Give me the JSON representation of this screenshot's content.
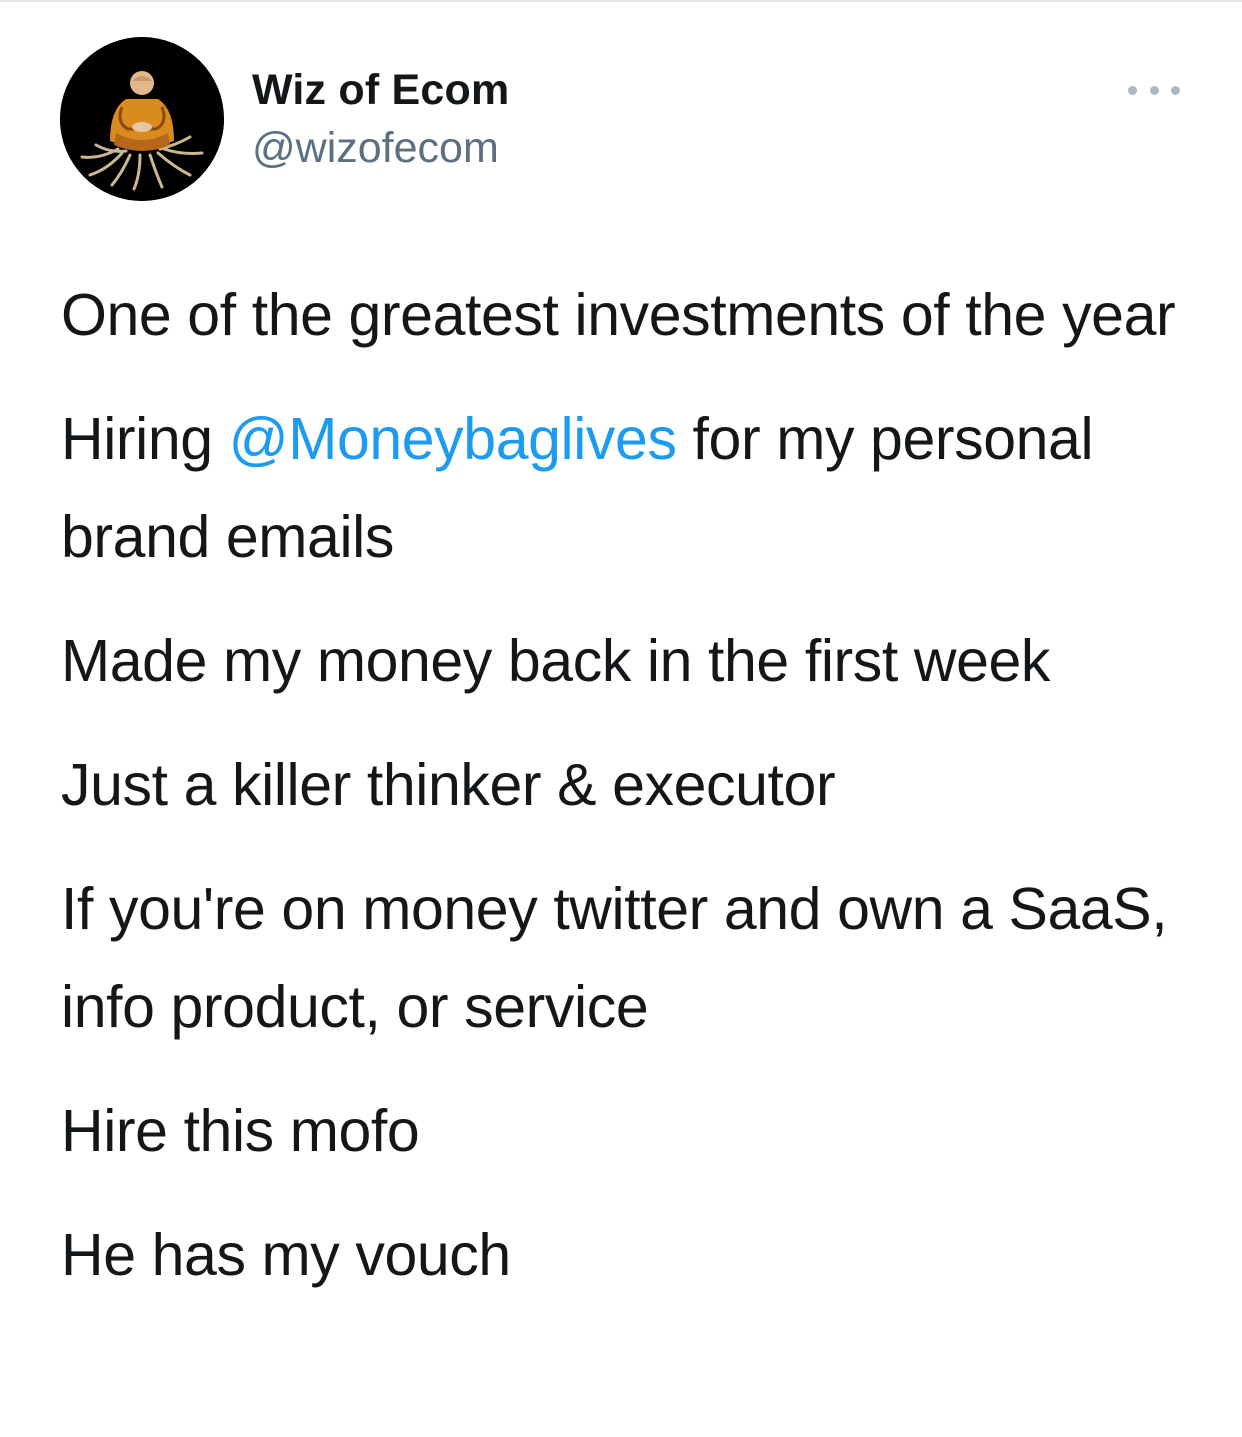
{
  "tweet": {
    "author": {
      "display_name": "Wiz of Ecom",
      "handle": "@wizofecom",
      "avatar_icon": "meditating-monk-avatar"
    },
    "more_icon": "more-options-icon",
    "lines": {
      "l1": "One of the greatest investments of the year",
      "l2_before": "Hiring ",
      "l2_mention": "@Moneybaglives",
      "l2_after": " for my personal brand emails",
      "l3": "Made my money back in the first week",
      "l4": "Just a killer thinker & executor",
      "l5": "If you're on money twitter and own a SaaS, info product, or service",
      "l6": "Hire this mofo",
      "l7": "He has my vouch"
    }
  },
  "colors": {
    "text": "#14171a",
    "secondary": "#5b7083",
    "link": "#1d9bf0",
    "background": "#ffffff"
  }
}
